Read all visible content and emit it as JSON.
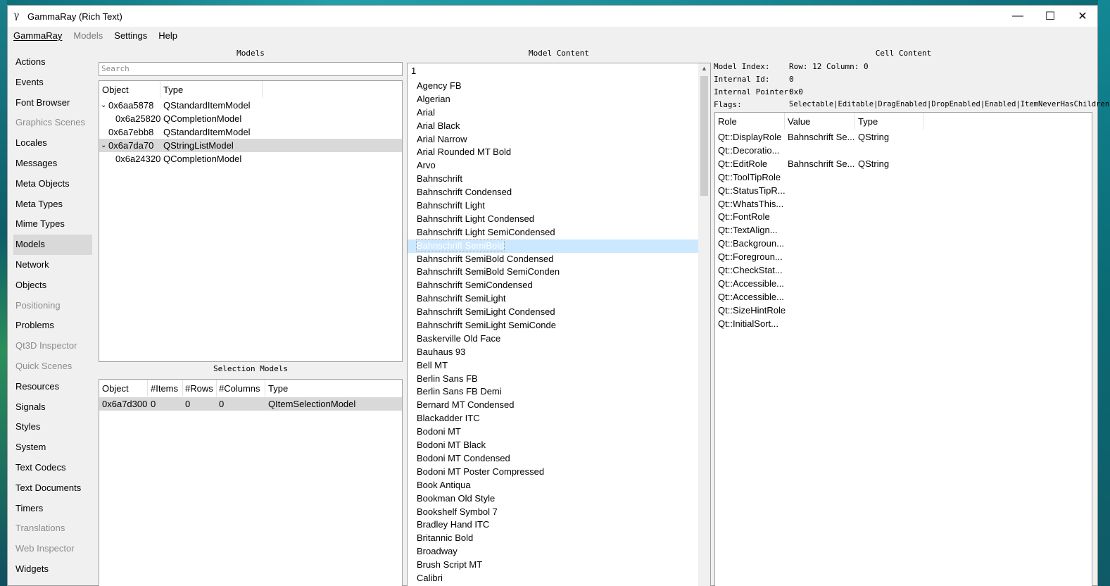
{
  "window": {
    "title": "GammaRay (Rich Text)",
    "app_icon_glyph": "γ",
    "minimize_glyph": "—",
    "maximize_glyph": "☐",
    "close_glyph": "✕"
  },
  "menubar": {
    "items": [
      "GammaRay",
      "Models",
      "Settings",
      "Help"
    ]
  },
  "nav": {
    "items": [
      {
        "label": "Actions",
        "disabled": false
      },
      {
        "label": "Events",
        "disabled": false
      },
      {
        "label": "Font Browser",
        "disabled": false
      },
      {
        "label": "Graphics Scenes",
        "disabled": true
      },
      {
        "label": "Locales",
        "disabled": false
      },
      {
        "label": "Messages",
        "disabled": false
      },
      {
        "label": "Meta Objects",
        "disabled": false
      },
      {
        "label": "Meta Types",
        "disabled": false
      },
      {
        "label": "Mime Types",
        "disabled": false
      },
      {
        "label": "Models",
        "disabled": false,
        "selected": true
      },
      {
        "label": "Network",
        "disabled": false
      },
      {
        "label": "Objects",
        "disabled": false
      },
      {
        "label": "Positioning",
        "disabled": true
      },
      {
        "label": "Problems",
        "disabled": false
      },
      {
        "label": "Qt3D Inspector",
        "disabled": true
      },
      {
        "label": "Quick Scenes",
        "disabled": true
      },
      {
        "label": "Resources",
        "disabled": false
      },
      {
        "label": "Signals",
        "disabled": false
      },
      {
        "label": "Styles",
        "disabled": false
      },
      {
        "label": "System",
        "disabled": false
      },
      {
        "label": "Text Codecs",
        "disabled": false
      },
      {
        "label": "Text Documents",
        "disabled": false
      },
      {
        "label": "Timers",
        "disabled": false
      },
      {
        "label": "Translations",
        "disabled": true
      },
      {
        "label": "Web Inspector",
        "disabled": true
      },
      {
        "label": "Widgets",
        "disabled": false
      }
    ]
  },
  "models": {
    "section_title": "Models",
    "search_placeholder": "Search",
    "headers": [
      "Object",
      "Type"
    ],
    "rows": [
      {
        "object": "0x6aa5878",
        "type": "QStandardItemModel",
        "expanded": true,
        "level": 0
      },
      {
        "object": "0x6a25820",
        "type": "QCompletionModel",
        "level": 1
      },
      {
        "object": "0x6a7ebb8",
        "type": "QStandardItemModel",
        "level": 0
      },
      {
        "object": "0x6a7da70",
        "type": "QStringListModel",
        "expanded": true,
        "level": 0,
        "selected": true
      },
      {
        "object": "0x6a24320",
        "type": "QCompletionModel",
        "level": 1
      }
    ]
  },
  "selection_models": {
    "section_title": "Selection Models",
    "headers": [
      "Object",
      "#Items",
      "#Rows",
      "#Columns",
      "Type"
    ],
    "rows": [
      {
        "object": "0x6a7d300",
        "items": "0",
        "rows": "0",
        "columns": "0",
        "type": "QItemSelectionModel"
      }
    ]
  },
  "model_content": {
    "section_title": "Model Content",
    "header_value": "1",
    "selected_index": 12,
    "items": [
      "Agency FB",
      "Algerian",
      "Arial",
      "Arial Black",
      "Arial Narrow",
      "Arial Rounded MT Bold",
      "Arvo",
      "Bahnschrift",
      "Bahnschrift Condensed",
      "Bahnschrift Light",
      "Bahnschrift Light Condensed",
      "Bahnschrift Light SemiCondensed",
      "Bahnschrift SemiBold",
      "Bahnschrift SemiBold Condensed",
      "Bahnschrift SemiBold SemiConden",
      "Bahnschrift SemiCondensed",
      "Bahnschrift SemiLight",
      "Bahnschrift SemiLight Condensed",
      "Bahnschrift SemiLight SemiConde",
      "Baskerville Old Face",
      "Bauhaus 93",
      "Bell MT",
      "Berlin Sans FB",
      "Berlin Sans FB Demi",
      "Bernard MT Condensed",
      "Blackadder ITC",
      "Bodoni MT",
      "Bodoni MT Black",
      "Bodoni MT Condensed",
      "Bodoni MT Poster Compressed",
      "Book Antiqua",
      "Bookman Old Style",
      "Bookshelf Symbol 7",
      "Bradley Hand ITC",
      "Britannic Bold",
      "Broadway",
      "Brush Script MT",
      "Calibri"
    ]
  },
  "cell_content": {
    "section_title": "Cell Content",
    "model_index_label": "Model Index:",
    "model_index_value": "Row: 12 Column: 0",
    "internal_id_label": "Internal Id:",
    "internal_id_value": "0",
    "internal_pointer_label": "Internal Pointer:",
    "internal_pointer_value": "0x0",
    "flags_label": "Flags:",
    "flags_value": "Selectable|Editable|DragEnabled|DropEnabled|Enabled|ItemNeverHasChildren",
    "headers": [
      "Role",
      "Value",
      "Type"
    ],
    "rows": [
      {
        "role": "Qt::DisplayRole",
        "value": "Bahnschrift Se...",
        "type": "QString"
      },
      {
        "role": "Qt::Decoratio...",
        "value": "",
        "type": ""
      },
      {
        "role": "Qt::EditRole",
        "value": "Bahnschrift Se...",
        "type": "QString"
      },
      {
        "role": "Qt::ToolTipRole",
        "value": "",
        "type": ""
      },
      {
        "role": "Qt::StatusTipR...",
        "value": "",
        "type": ""
      },
      {
        "role": "Qt::WhatsThis...",
        "value": "",
        "type": ""
      },
      {
        "role": "Qt::FontRole",
        "value": "",
        "type": ""
      },
      {
        "role": "Qt::TextAlign...",
        "value": "",
        "type": ""
      },
      {
        "role": "Qt::Backgroun...",
        "value": "",
        "type": ""
      },
      {
        "role": "Qt::Foregroun...",
        "value": "",
        "type": ""
      },
      {
        "role": "Qt::CheckStat...",
        "value": "",
        "type": ""
      },
      {
        "role": "Qt::Accessible...",
        "value": "",
        "type": ""
      },
      {
        "role": "Qt::Accessible...",
        "value": "",
        "type": ""
      },
      {
        "role": "Qt::SizeHintRole",
        "value": "",
        "type": ""
      },
      {
        "role": "Qt::InitialSort...",
        "value": "",
        "type": ""
      }
    ]
  }
}
